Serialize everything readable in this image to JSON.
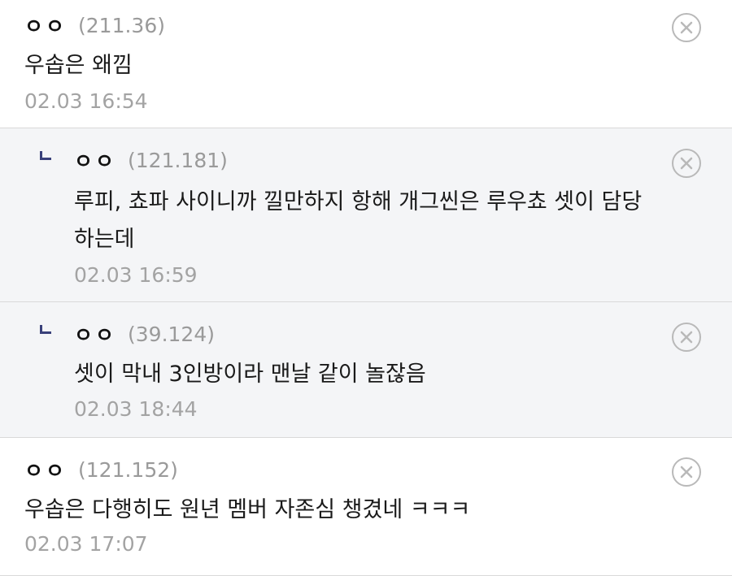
{
  "comments": [
    {
      "author": "ㅇㅇ",
      "ip": "(211.36)",
      "text": "우솝은 왜낌",
      "time": "02.03 16:54",
      "is_reply": false
    },
    {
      "author": "ㅇㅇ",
      "ip": "(121.181)",
      "text_line1": "루피, 쵸파 사이니까 낄만하지 항해 개그씬은 루우쵸 셋이 담당",
      "text_line2": "하는데",
      "time": "02.03 16:59",
      "is_reply": true
    },
    {
      "author": "ㅇㅇ",
      "ip": "(39.124)",
      "text": "셋이 막내 3인방이라 맨날 같이 놀잖음",
      "time": "02.03 18:44",
      "is_reply": true
    },
    {
      "author": "ㅇㅇ",
      "ip": "(121.152)",
      "text": "우솝은 다행히도 원년 멤버 자존심 챙겼네 ㅋㅋㅋ",
      "time": "02.03 17:07",
      "is_reply": false
    }
  ],
  "icons": {
    "delete": "close-circle-icon",
    "reply": "reply-arrow-icon"
  },
  "colors": {
    "reply_background": "#f4f5f7",
    "reply_arrow": "#39407a",
    "meta_gray": "#9a9a9a",
    "divider": "#d9d9d9"
  }
}
